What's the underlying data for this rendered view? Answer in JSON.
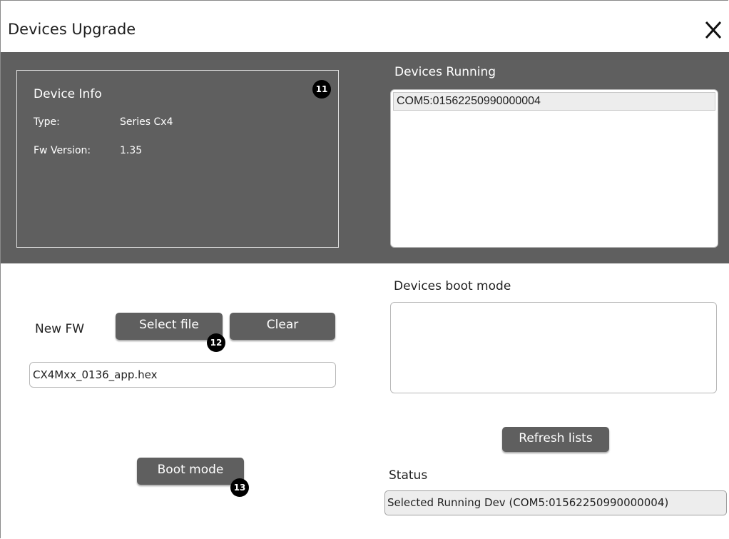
{
  "window": {
    "title": "Devices Upgrade"
  },
  "device_info": {
    "title": "Device Info",
    "type_label": "Type:",
    "type_value": "Series Cx4",
    "fw_label": "Fw Version:",
    "fw_value": "1.35"
  },
  "devices_running": {
    "label": "Devices Running",
    "items": [
      "COM5:01562250990000004"
    ]
  },
  "devices_boot_mode": {
    "label": "Devices boot mode",
    "items": []
  },
  "new_fw": {
    "label": "New FW",
    "select_button": "Select file",
    "clear_button": "Clear",
    "file_value": "CX4Mxx_0136_app.hex"
  },
  "buttons": {
    "refresh": "Refresh lists",
    "boot_mode": "Boot mode"
  },
  "status": {
    "label": "Status",
    "value": "Selected Running Dev (COM5:01562250990000004)"
  },
  "markers": [
    "11",
    "12",
    "13"
  ],
  "colors": {
    "panel_bg": "#5f5f5f",
    "button_bg": "#5f5f5f",
    "marker_bg": "#000000"
  },
  "icons": {
    "close": "close-icon"
  }
}
